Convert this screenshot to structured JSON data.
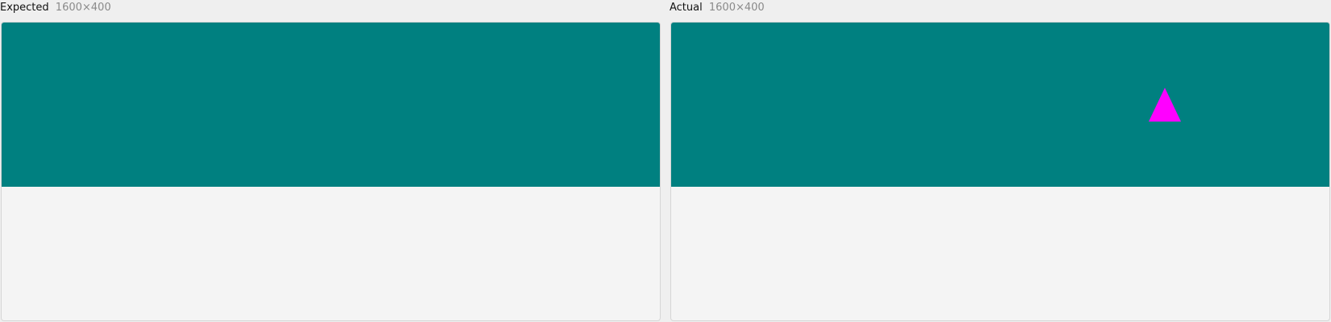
{
  "panels": {
    "expected": {
      "label": "Expected",
      "dimensions": "1600×400"
    },
    "actual": {
      "label": "Actual",
      "dimensions": "1600×400"
    }
  },
  "colors": {
    "banner": "#008080",
    "body": "#f4f4f4",
    "marker": "#ff00ff",
    "page_background": "#efefef",
    "dimension_text": "#8a8a8a"
  },
  "icons": {
    "actual_marker": "triangle-icon"
  }
}
